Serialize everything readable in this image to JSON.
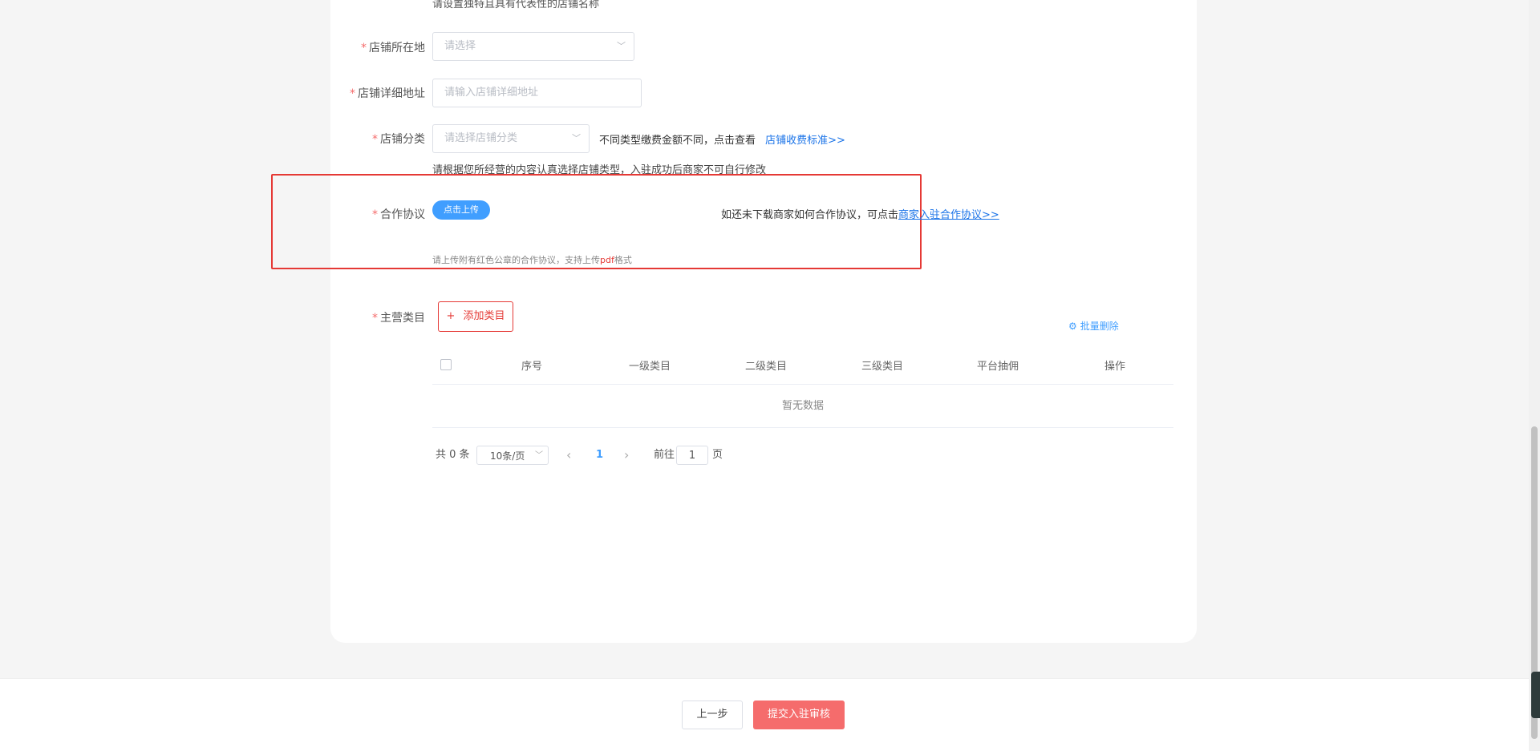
{
  "form": {
    "name_hint": "请设置独特且具有代表性的店铺名称",
    "location": {
      "required": "*",
      "label": "店铺所在地",
      "placeholder": "请选择"
    },
    "address": {
      "required": "*",
      "label": "店铺详细地址",
      "placeholder": "请输入店铺详细地址"
    },
    "category": {
      "required": "*",
      "label": "店铺分类",
      "placeholder": "请选择店铺分类",
      "note": "不同类型缴费金额不同，点击查看",
      "note_link": "店铺收费标准>>",
      "hint": "请根据您所经营的内容认真选择店铺类型，入驻成功后商家不可自行修改"
    },
    "agreement": {
      "required": "*",
      "label": "合作协议",
      "upload_button": "点击上传",
      "download_note": "如还未下载商家如何合作协议，可点击",
      "download_link": "商家入驻合作协议>>",
      "hint_prefix": "请上传附有红色公章的合作协议，支持上传",
      "hint_format": "pdf",
      "hint_suffix": "格式"
    },
    "main_category": {
      "required": "*",
      "label": "主营类目",
      "add_button_icon": "+",
      "add_button": "添加类目",
      "batch_delete": "批量删除"
    }
  },
  "table": {
    "columns": [
      "序号",
      "一级类目",
      "二级类目",
      "三级类目",
      "平台抽佣",
      "操作"
    ],
    "empty_text": "暂无数据"
  },
  "pagination": {
    "total": "共 0 条",
    "page_size": "10条/页",
    "prev": "‹",
    "current_page": "1",
    "next": "›",
    "goto_prefix": "前往",
    "goto_value": "1",
    "goto_suffix": "页"
  },
  "footer": {
    "prev_button": "上一步",
    "submit_button": "提交入驻审核"
  },
  "colors": {
    "accent": "#409eff",
    "danger": "#f56c6c",
    "highlight_box": "#e53935"
  }
}
